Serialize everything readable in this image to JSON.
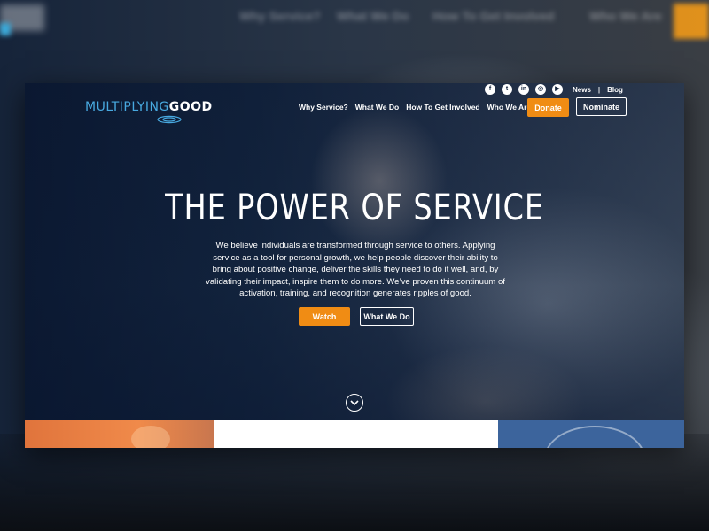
{
  "brand": {
    "logo_part1": "MULTIPLYING",
    "logo_part2": "GOOD",
    "accent_blue": "#48a9e0",
    "accent_orange": "#f08c14"
  },
  "social": [
    "facebook-icon",
    "twitter-icon",
    "linkedin-icon",
    "instagram-icon",
    "youtube-icon"
  ],
  "utility": {
    "news": "News",
    "separator": "|",
    "blog": "Blog"
  },
  "nav": {
    "items": [
      "Why Service?",
      "What We Do",
      "How To Get Involved",
      "Who We Are"
    ],
    "donate": "Donate",
    "nominate": "Nominate"
  },
  "hero": {
    "title": "THE POWER OF SERVICE",
    "body": "We believe individuals are transformed through service to others. Applying service as a tool for personal growth, we help people discover their ability to bring about positive change, deliver the skills they need to do it well, and, by validating their impact, inspire them to do more. We’ve proven this continuum of activation, training, and recognition generates ripples of good.",
    "watch": "Watch",
    "what_we_do": "What We Do"
  }
}
